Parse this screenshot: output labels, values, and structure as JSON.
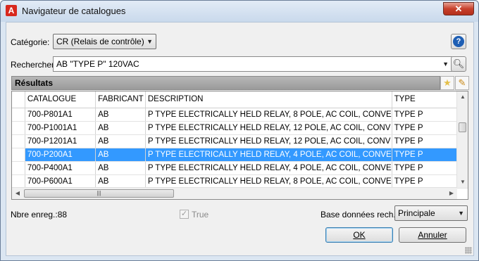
{
  "window": {
    "title": "Navigateur de catalogues",
    "app_icon_letter": "A",
    "close_glyph": "✕"
  },
  "category": {
    "label": "Catégorie:",
    "value": "CR (Relais de contrôle)"
  },
  "search": {
    "label": "Rechercher:",
    "value": "AB \"TYPE P\" 120VAC"
  },
  "help": {
    "glyph": "?"
  },
  "results": {
    "title": "Résultats",
    "columns": [
      "CATALOGUE",
      "FABRICANT",
      "DESCRIPTION",
      "TYPE"
    ],
    "rows": [
      {
        "catalogue": "700-P801A1",
        "fabricant": "AB",
        "description": "P TYPE ELECTRICALLY HELD RELAY, 8 POLE, AC COIL, CONVE",
        "type": "TYPE P"
      },
      {
        "catalogue": "700-P1001A1",
        "fabricant": "AB",
        "description": "P TYPE ELECTRICALLY HELD RELAY, 12 POLE, AC COIL, CONV",
        "type": "TYPE P"
      },
      {
        "catalogue": "700-P1201A1",
        "fabricant": "AB",
        "description": "P TYPE ELECTRICALLY HELD RELAY, 12 POLE, AC COIL, CONV",
        "type": "TYPE P"
      },
      {
        "catalogue": "700-P200A1",
        "fabricant": "AB",
        "description": "P TYPE ELECTRICALLY HELD RELAY, 4 POLE, AC COIL, CONVE",
        "type": "TYPE P"
      },
      {
        "catalogue": "700-P400A1",
        "fabricant": "AB",
        "description": "P TYPE ELECTRICALLY HELD RELAY, 4 POLE, AC COIL, CONVE",
        "type": "TYPE P"
      },
      {
        "catalogue": "700-P600A1",
        "fabricant": "AB",
        "description": "P TYPE ELECTRICALLY HELD RELAY, 8 POLE, AC COIL, CONVE",
        "type": "TYPE P"
      }
    ],
    "selected_row_index": 3
  },
  "record_count": {
    "label": "Nbre enreg.:88"
  },
  "true_checkbox": {
    "label": "True",
    "checked": true,
    "enabled": false
  },
  "database": {
    "label": "Base données rech.:",
    "value": "Principale"
  },
  "buttons": {
    "ok": "OK",
    "cancel": "Annuler"
  },
  "colors": {
    "selection": "#3399ff",
    "title_bar": "#c9d9ec",
    "close_button": "#c7402c"
  }
}
